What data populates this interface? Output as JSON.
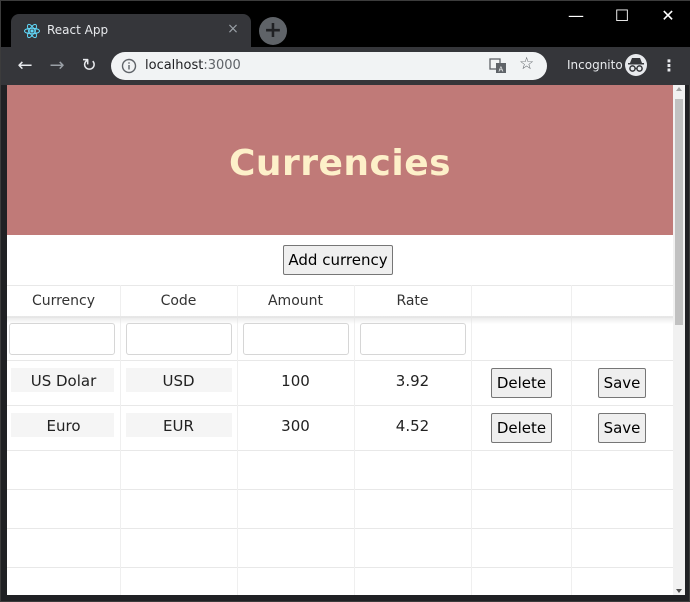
{
  "browser": {
    "tab_title": "React App",
    "tab_close": "×",
    "new_tab": "+",
    "url_host": "localhost",
    "url_port": ":3000",
    "incognito_label": "Incognito",
    "window_controls": {
      "minimize": "—",
      "maximize": "☐",
      "close": "✕"
    },
    "nav": {
      "back": "←",
      "forward": "→",
      "reload": "↻",
      "menu": "⋮",
      "star": "☆"
    }
  },
  "page": {
    "title": "Currencies",
    "add_button": "Add currency",
    "columns": [
      "Currency",
      "Code",
      "Amount",
      "Rate"
    ],
    "rows": [
      {
        "currency": "US Dolar",
        "code": "USD",
        "amount": "100",
        "rate": "3.92",
        "delete_label": "Delete",
        "save_label": "Save"
      },
      {
        "currency": "Euro",
        "code": "EUR",
        "amount": "300",
        "rate": "4.52",
        "delete_label": "Delete",
        "save_label": "Save"
      }
    ]
  },
  "colors": {
    "header_bg": "#c07a78",
    "title_color": "#fdf0c9"
  }
}
